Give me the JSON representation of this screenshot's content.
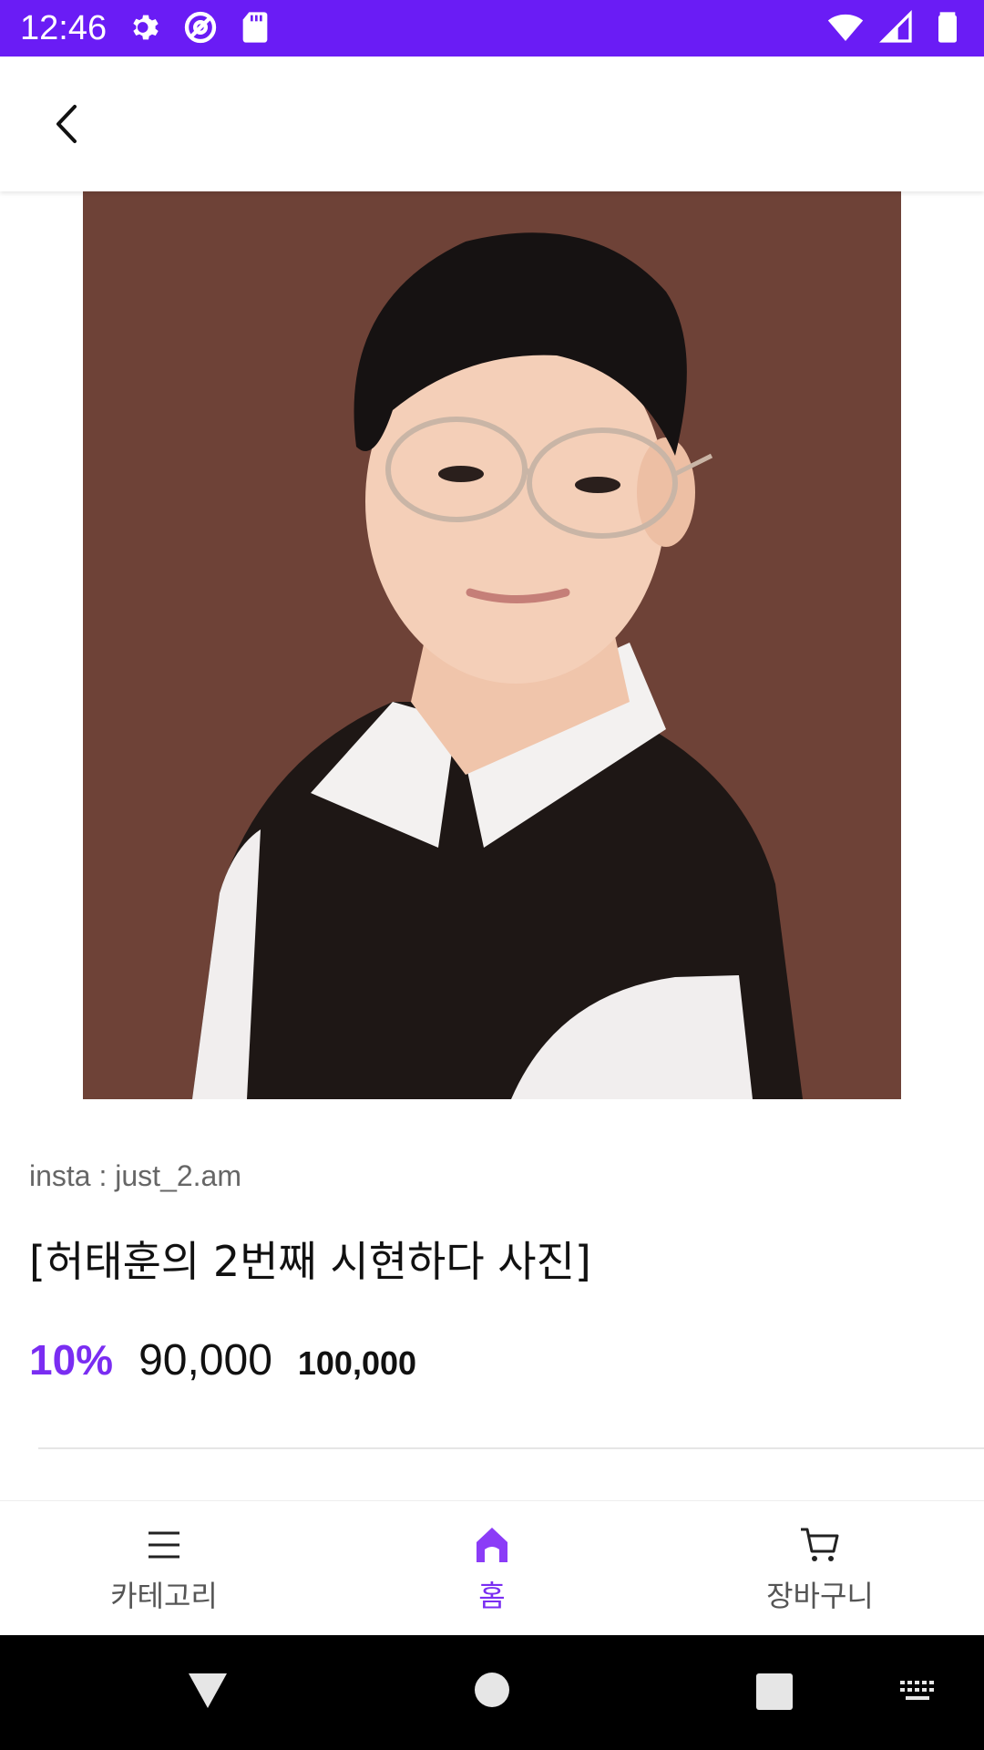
{
  "status_bar": {
    "time": "12:46",
    "left_icons": [
      "settings-icon",
      "at-sign-icon",
      "sd-card-icon"
    ],
    "right_icons": [
      "wifi-icon",
      "signal-icon",
      "battery-icon"
    ],
    "background": "#6a1cf5"
  },
  "app_bar": {
    "back_icon": "chevron-left-icon"
  },
  "product": {
    "seller": "insta : just_2.am",
    "title": "[허태훈의 2번째 시현하다 사진]",
    "discount": "10%",
    "price": "90,000",
    "original_price": "100,000",
    "accent_color": "#7a2df2"
  },
  "bottom_nav": {
    "items": [
      {
        "label": "카테고리",
        "icon": "menu-icon",
        "active": false
      },
      {
        "label": "홈",
        "icon": "home-icon",
        "active": true
      },
      {
        "label": "장바구니",
        "icon": "cart-icon",
        "active": false
      }
    ]
  },
  "system_nav": {
    "buttons": [
      "back-triangle-icon",
      "home-circle-icon",
      "recents-square-icon",
      "keyboard-icon"
    ]
  }
}
